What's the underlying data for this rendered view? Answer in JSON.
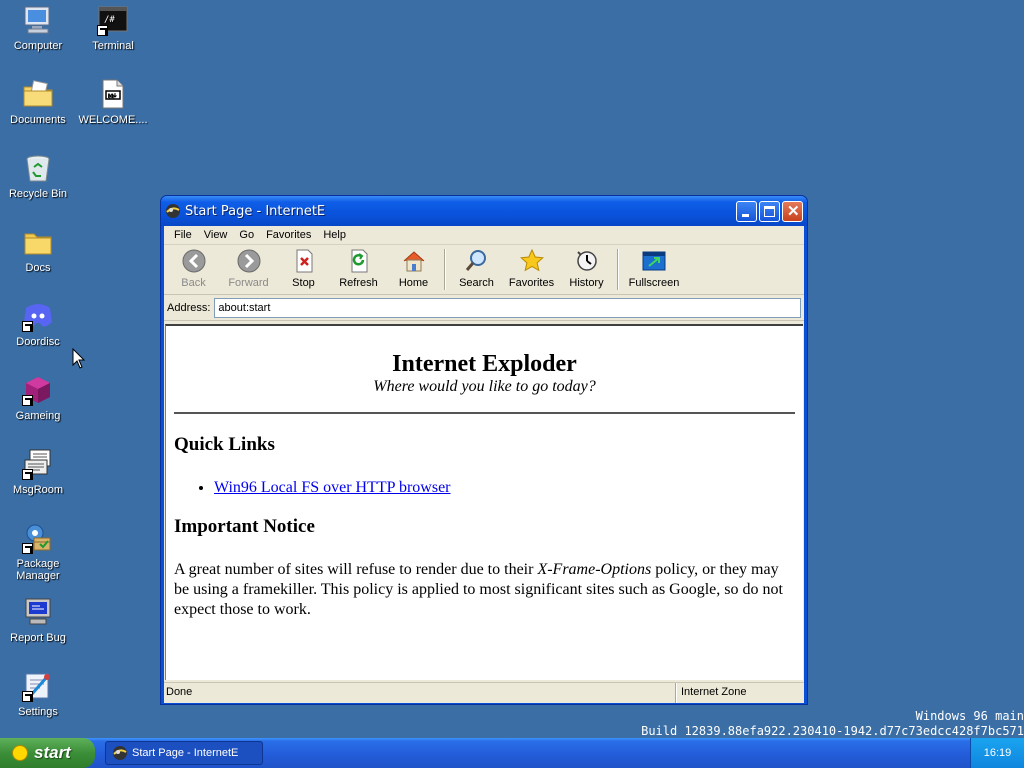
{
  "desktop": {
    "icons": [
      {
        "label": "Computer",
        "icon": "computer-icon"
      },
      {
        "label": "Terminal",
        "icon": "terminal-icon"
      },
      {
        "label": "Documents",
        "icon": "documents-folder-icon"
      },
      {
        "label": "WELCOME....",
        "icon": "markdown-file-icon"
      },
      {
        "label": "Recycle Bin",
        "icon": "recycle-bin-icon"
      },
      {
        "label": "Docs",
        "icon": "folder-icon"
      },
      {
        "label": "Doordisc",
        "icon": "doordisc-icon"
      },
      {
        "label": "Gameing",
        "icon": "cube-icon"
      },
      {
        "label": "MsgRoom",
        "icon": "msgroom-icon"
      },
      {
        "label": "Package Manager",
        "icon": "package-manager-icon"
      },
      {
        "label": "Report Bug",
        "icon": "report-bug-icon"
      },
      {
        "label": "Settings",
        "icon": "settings-icon"
      }
    ]
  },
  "window": {
    "title": "Start Page - InternetE",
    "menu": [
      "File",
      "View",
      "Go",
      "Favorites",
      "Help"
    ],
    "toolbar": {
      "back": "Back",
      "forward": "Forward",
      "stop": "Stop",
      "refresh": "Refresh",
      "home": "Home",
      "search": "Search",
      "favorites": "Favorites",
      "history": "History",
      "fullscreen": "Fullscreen"
    },
    "address_label": "Address:",
    "address_value": "about:start",
    "page": {
      "heading": "Internet Exploder",
      "subtitle": "Where would you like to go today?",
      "quick_links_heading": "Quick Links",
      "quick_links": [
        "Win96 Local FS over HTTP browser"
      ],
      "notice_heading": "Important Notice",
      "notice_before": "A great number of sites will refuse to render due to their ",
      "notice_em": "X-Frame-Options",
      "notice_after": " policy, or they may be using a framekiller. This policy is applied to most significant sites such as Google, so do not expect those to work."
    },
    "status_left": "Done",
    "status_right": "Internet Zone"
  },
  "build_info": {
    "line1": "Windows 96 main",
    "line2": "Build 12839.88efa922.230410-1942.d77c73edcc428f7bc571"
  },
  "taskbar": {
    "start_label": "start",
    "task_title": "Start Page - InternetE",
    "clock": "16:19"
  },
  "colors": {
    "desktop": "#3a6ea5",
    "titlebar": "#0a53dc",
    "start": "#3c8f38",
    "link": "#0000ee"
  }
}
